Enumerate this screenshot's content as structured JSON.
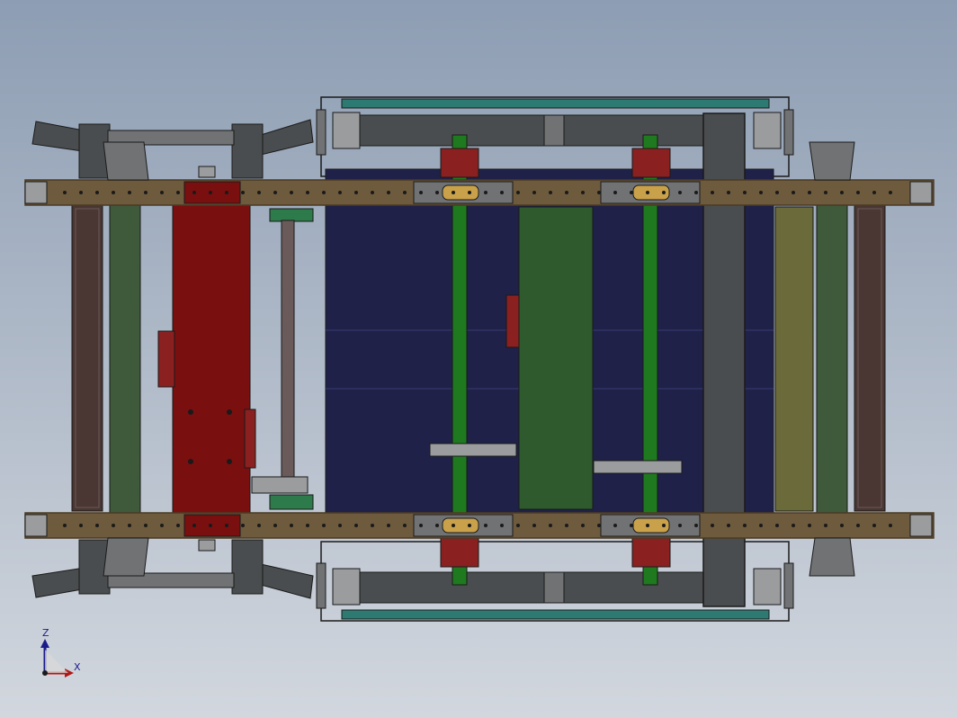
{
  "view": {
    "background_top": "#8d9db3",
    "background_bottom": "#d2d7de"
  },
  "colors": {
    "outline": "#1a1a1a",
    "dark_gray": "#4a4d4f",
    "mid_gray": "#707274",
    "light_gray": "#9a9c9e",
    "navy": "#1f2148",
    "navy_line": "#3a3d72",
    "brown_rail": "#6e5b3d",
    "rail_edge": "#4a3b24",
    "red": "#7a0f0f",
    "green_shaft": "#1f7a1f",
    "olive_green": "#3f5a3a",
    "plate_green": "#2e5a2e",
    "olive_panel": "#6b6a3a",
    "dark_brown": "#4a3632",
    "rod": "#6b5a5a",
    "teal_rail": "#2d7a72",
    "gold": "#c9a14a",
    "maroon": "#8a2020",
    "triad_blue": "#1b1b8a",
    "triad_red": "#b01818"
  },
  "triad": {
    "z_label": "Z",
    "x_label": "X"
  }
}
